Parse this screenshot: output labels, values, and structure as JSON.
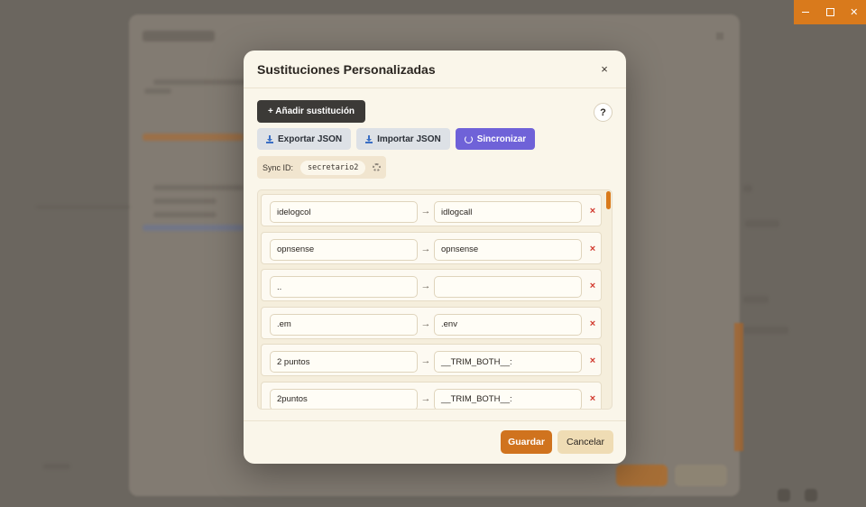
{
  "window": {
    "min_label": "–",
    "max_label": "□",
    "close_label": "✕"
  },
  "modal": {
    "title": "Sustituciones Personalizadas",
    "close_label": "×",
    "add_button": "+ Añadir sustitución",
    "help_label": "?",
    "export_button": "Exportar JSON",
    "import_button": "Importar JSON",
    "sync_button": "Sincronizar",
    "sync_id_label": "Sync ID:",
    "sync_id_value": "secretario2",
    "arrow_glyph": "→",
    "delete_glyph": "×",
    "substitutions": [
      {
        "from": "idelogcol",
        "to": "idlogcall"
      },
      {
        "from": "opnsense",
        "to": "opnsense"
      },
      {
        "from": "..",
        "to": ""
      },
      {
        "from": ".em",
        "to": ".env"
      },
      {
        "from": "2 puntos",
        "to": "__TRIM_BOTH__:"
      },
      {
        "from": "2puntos",
        "to": "__TRIM_BOTH__:"
      }
    ],
    "save_button": "Guardar",
    "cancel_button": "Cancelar"
  },
  "colors": {
    "accent_orange": "#d0731e",
    "sync_purple": "#6f62d8",
    "delete_red": "#d23b30"
  }
}
